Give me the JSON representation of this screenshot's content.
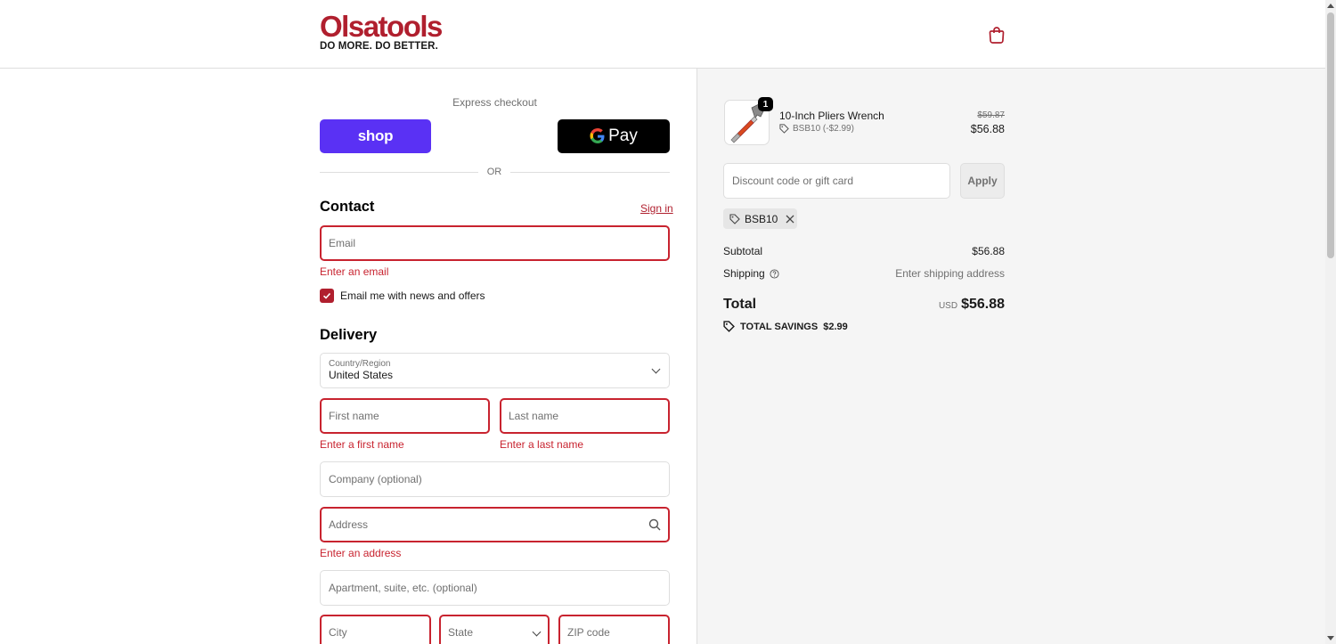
{
  "header": {
    "logo_text": "Olsatools",
    "logo_tagline": "DO MORE. DO BETTER.",
    "cart_icon": "shopping-bag-icon"
  },
  "express": {
    "title": "Express checkout",
    "shop_label": "shop",
    "gpay_label": "Pay",
    "divider_text": "OR"
  },
  "contact": {
    "heading": "Contact",
    "sign_in": "Sign in",
    "email_placeholder": "Email",
    "email_error": "Enter an email",
    "news_label": "Email me with news and offers",
    "news_checked": true
  },
  "delivery": {
    "heading": "Delivery",
    "country_label": "Country/Region",
    "country_value": "United States",
    "first_name": "First name",
    "first_name_error": "Enter a first name",
    "last_name": "Last name",
    "last_name_error": "Enter a last name",
    "company": "Company (optional)",
    "address": "Address",
    "address_error": "Enter an address",
    "apartment": "Apartment, suite, etc. (optional)",
    "city": "City",
    "state": "State",
    "zip": "ZIP code"
  },
  "summary": {
    "product": {
      "name": "10-Inch Pliers Wrench",
      "quantity": "1",
      "discount": "BSB10 (-$2.99)",
      "old_price": "$59.87",
      "price": "$56.88"
    },
    "discount_placeholder": "Discount code or gift card",
    "apply_label": "Apply",
    "applied_code": "BSB10",
    "subtotal_label": "Subtotal",
    "subtotal_value": "$56.88",
    "shipping_label": "Shipping",
    "shipping_value": "Enter shipping address",
    "total_label": "Total",
    "currency": "USD",
    "total_value": "$56.88",
    "savings_label": "TOTAL SAVINGS",
    "savings_value": "$2.99"
  },
  "colors": {
    "brand": "#b01f2e",
    "error": "#c8232f",
    "shop_pay": "#5a31f4"
  }
}
